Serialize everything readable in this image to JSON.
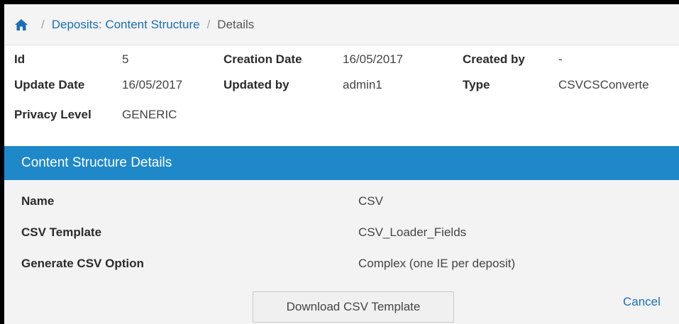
{
  "breadcrumb": {
    "home_icon": "home-icon",
    "separator": "/",
    "link": "Deposits: Content Structure",
    "current": "Details"
  },
  "meta": {
    "row1": [
      {
        "label": "Id",
        "value": "5"
      },
      {
        "label": "Creation Date",
        "value": "16/05/2017"
      },
      {
        "label": "Created by",
        "value": "-"
      }
    ],
    "row2": [
      {
        "label": "Update Date",
        "value": "16/05/2017"
      },
      {
        "label": "Updated by",
        "value": "admin1"
      },
      {
        "label": "Type",
        "value": "CSVCSConverte"
      }
    ],
    "row3": [
      {
        "label": "Privacy Level",
        "value": "GENERIC"
      }
    ]
  },
  "section": {
    "title": "Content Structure Details",
    "color": "#1e88c9"
  },
  "details": [
    {
      "label": "Name",
      "value": "CSV"
    },
    {
      "label": "CSV Template",
      "value": "CSV_Loader_Fields"
    },
    {
      "label": "Generate CSV Option",
      "value": "Complex (one IE per deposit)"
    }
  ],
  "footer": {
    "download_label": "Download CSV Template",
    "cancel_label": "Cancel"
  }
}
